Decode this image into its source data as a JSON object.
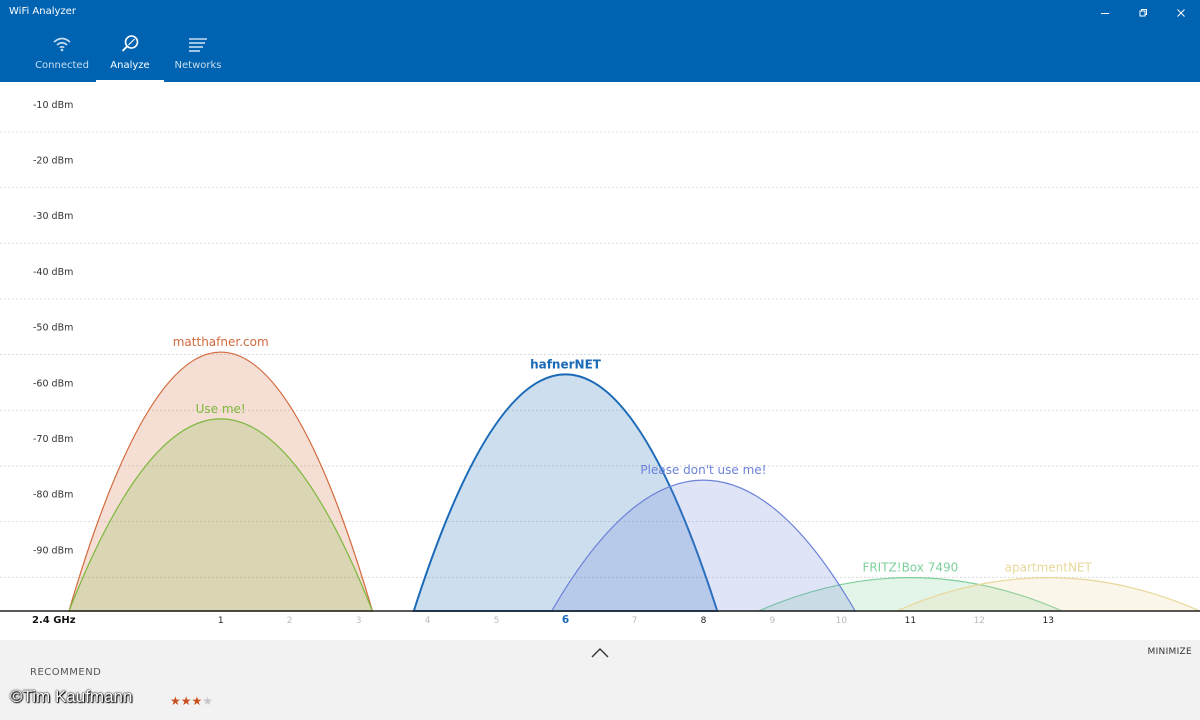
{
  "app": {
    "title": "WiFi Analyzer"
  },
  "tabs": [
    {
      "label": "Connected",
      "icon": "wifi-icon",
      "active": false
    },
    {
      "label": "Analyze",
      "icon": "analyze-icon",
      "active": true
    },
    {
      "label": "Networks",
      "icon": "list-icon",
      "active": false
    }
  ],
  "bottom": {
    "recommend_label": "RECOMMEND",
    "minimize_label": "MINIMIZE",
    "rating": 3,
    "rating_max": 4,
    "watermark": "©Tim Kaufmann"
  },
  "chart_data": {
    "type": "area",
    "band_label": "2.4 GHz",
    "yticks": [
      {
        "value": -10,
        "label": "-10 dBm"
      },
      {
        "value": -20,
        "label": "-20 dBm"
      },
      {
        "value": -30,
        "label": "-30 dBm"
      },
      {
        "value": -40,
        "label": "-40 dBm"
      },
      {
        "value": -50,
        "label": "-50 dBm"
      },
      {
        "value": -60,
        "label": "-60 dBm"
      },
      {
        "value": -70,
        "label": "-70 dBm"
      },
      {
        "value": -80,
        "label": "-80 dBm"
      },
      {
        "value": -90,
        "label": "-90 dBm"
      }
    ],
    "ylim": [
      -100,
      -5
    ],
    "xlim": [
      -2.2,
      15.2
    ],
    "channels": [
      {
        "value": 1,
        "label": "1",
        "emphasis": "normal"
      },
      {
        "value": 2,
        "label": "2",
        "emphasis": "dim"
      },
      {
        "value": 3,
        "label": "3",
        "emphasis": "dim"
      },
      {
        "value": 4,
        "label": "4",
        "emphasis": "dim"
      },
      {
        "value": 5,
        "label": "5",
        "emphasis": "dim"
      },
      {
        "value": 6,
        "label": "6",
        "emphasis": "bold"
      },
      {
        "value": 7,
        "label": "7",
        "emphasis": "dim"
      },
      {
        "value": 8,
        "label": "8",
        "emphasis": "normal"
      },
      {
        "value": 9,
        "label": "9",
        "emphasis": "dim"
      },
      {
        "value": 10,
        "label": "10",
        "emphasis": "dim"
      },
      {
        "value": 11,
        "label": "11",
        "emphasis": "normal"
      },
      {
        "value": 12,
        "label": "12",
        "emphasis": "dim"
      },
      {
        "value": 13,
        "label": "13",
        "emphasis": "normal"
      }
    ],
    "series": [
      {
        "name": "FRITZ!Box 7490",
        "channel": 11,
        "width_channels": 4.4,
        "level": -94,
        "color": "#7ed09c",
        "bold": false
      },
      {
        "name": "apartmentNET",
        "channel": 13,
        "width_channels": 4.4,
        "level": -94,
        "color": "#e8d89a",
        "bold": false
      },
      {
        "name": "matthafner.com",
        "channel": 1,
        "width_channels": 4.4,
        "level": -53.5,
        "color": "#d2693c",
        "bold": false
      },
      {
        "name": "Use me!",
        "channel": 1,
        "width_channels": 4.4,
        "level": -65.5,
        "color": "#7cb83c",
        "bold": false
      },
      {
        "name": "hafnerNET",
        "channel": 6,
        "width_channels": 4.4,
        "level": -57.5,
        "color": "#1a6ab8",
        "bold": true
      },
      {
        "name": "Please don't use me!",
        "channel": 8,
        "width_channels": 4.4,
        "level": -76.5,
        "color": "#6c82d8",
        "bold": false
      }
    ]
  }
}
